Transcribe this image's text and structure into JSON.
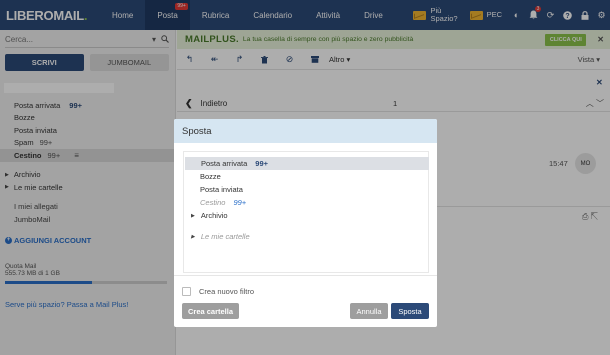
{
  "topbar": {
    "logo_part1": "LIBERO",
    "logo_part2": "MAIL",
    "logo_dot": ".",
    "nav": [
      {
        "label": "Home"
      },
      {
        "label": "Posta",
        "badge": "99+"
      },
      {
        "label": "Rubrica"
      },
      {
        "label": "Calendario"
      },
      {
        "label": "Attività"
      },
      {
        "label": "Drive"
      }
    ],
    "more_space_line1": "Più",
    "more_space_line2": "Spazio?",
    "pec_label": "PEC",
    "notification_badge": "3"
  },
  "sidebar": {
    "search_placeholder": "Cerca...",
    "compose_label": "SCRIVI",
    "jumbomail_label": "JUMBOMAIL",
    "folders": [
      {
        "label": "Posta arrivata",
        "count": "99+"
      },
      {
        "label": "Bozze"
      },
      {
        "label": "Posta inviata"
      },
      {
        "label": "Spam",
        "count": "99+"
      },
      {
        "label": "Cestino",
        "count": "99+",
        "selected": true
      }
    ],
    "archive_label": "Archivio",
    "my_folders_label": "Le mie cartelle",
    "attachments_label": "I miei allegati",
    "jumbomail_link": "JumboMail",
    "add_account_label": "AGGIUNGI ACCOUNT",
    "quota_title": "Quota Mail",
    "quota_text": "555.73 MB di 1 GB",
    "quota_fraction": 0.54,
    "more_space_text": "Serve più spazio? Passa a Mail Plus!"
  },
  "promo": {
    "logo": "MAILPLUS.",
    "text": "La tua casella di sempre con più spazio e zero pubblicità",
    "button": "CLICCA QUI"
  },
  "toolbar": {
    "altro_label": "Altro",
    "vista_label": "Vista"
  },
  "reader": {
    "back_label": "Indietro",
    "page": "1",
    "time": "15:47",
    "avatar": "MO"
  },
  "modal": {
    "title": "Sposta",
    "folders": [
      {
        "label": "Posta arrivata",
        "count": "99+",
        "selected": true
      },
      {
        "label": "Bozze"
      },
      {
        "label": "Posta inviata"
      },
      {
        "label": "Cestino",
        "count": "99+",
        "disabled": true
      },
      {
        "label": "Archivio",
        "expandable": true
      },
      {
        "label": "Le mie cartelle",
        "expandable": true,
        "disabled": true
      }
    ],
    "filter_label": "Crea nuovo filtro",
    "create_folder_label": "Crea cartella",
    "cancel_label": "Annulla",
    "move_label": "Sposta"
  },
  "colors": {
    "brand_blue": "#2c4a78",
    "accent_green": "#8bc34a",
    "link_blue": "#2a6fc9",
    "alert_red": "#e53935"
  }
}
